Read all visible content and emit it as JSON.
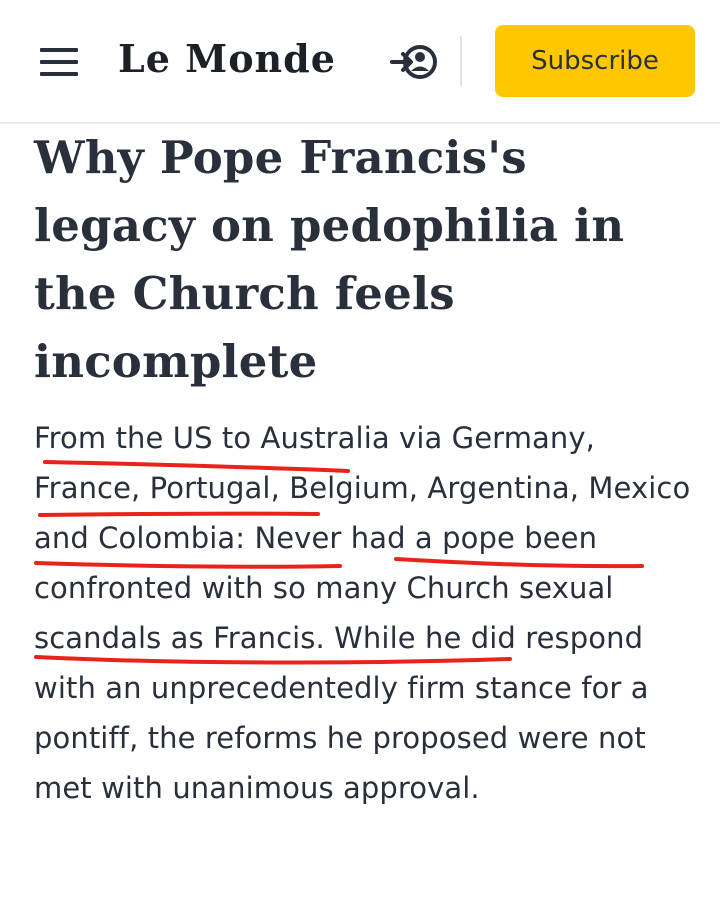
{
  "header": {
    "logo": "Le Monde",
    "menu_icon": "hamburger-menu-icon",
    "login_icon": "login-user-icon",
    "subscribe_label": "Subscribe"
  },
  "article": {
    "title": "Why Pope Francis's legacy on pedophilia in the Church feels incomplete",
    "lead": "From the US to Australia via Germany, France, Portugal, Belgium, Argentina, Mexico and Colombia: Never had a pope been confronted with so many Church sexual scandals as Francis. While he did respond with an unprecedentedly firm stance for a pontiff, the reforms he proposed were not met with unanimous approval."
  },
  "colors": {
    "subscribe_bg": "#ffc700",
    "text": "#2a303b",
    "annotation": "#e8231a"
  }
}
